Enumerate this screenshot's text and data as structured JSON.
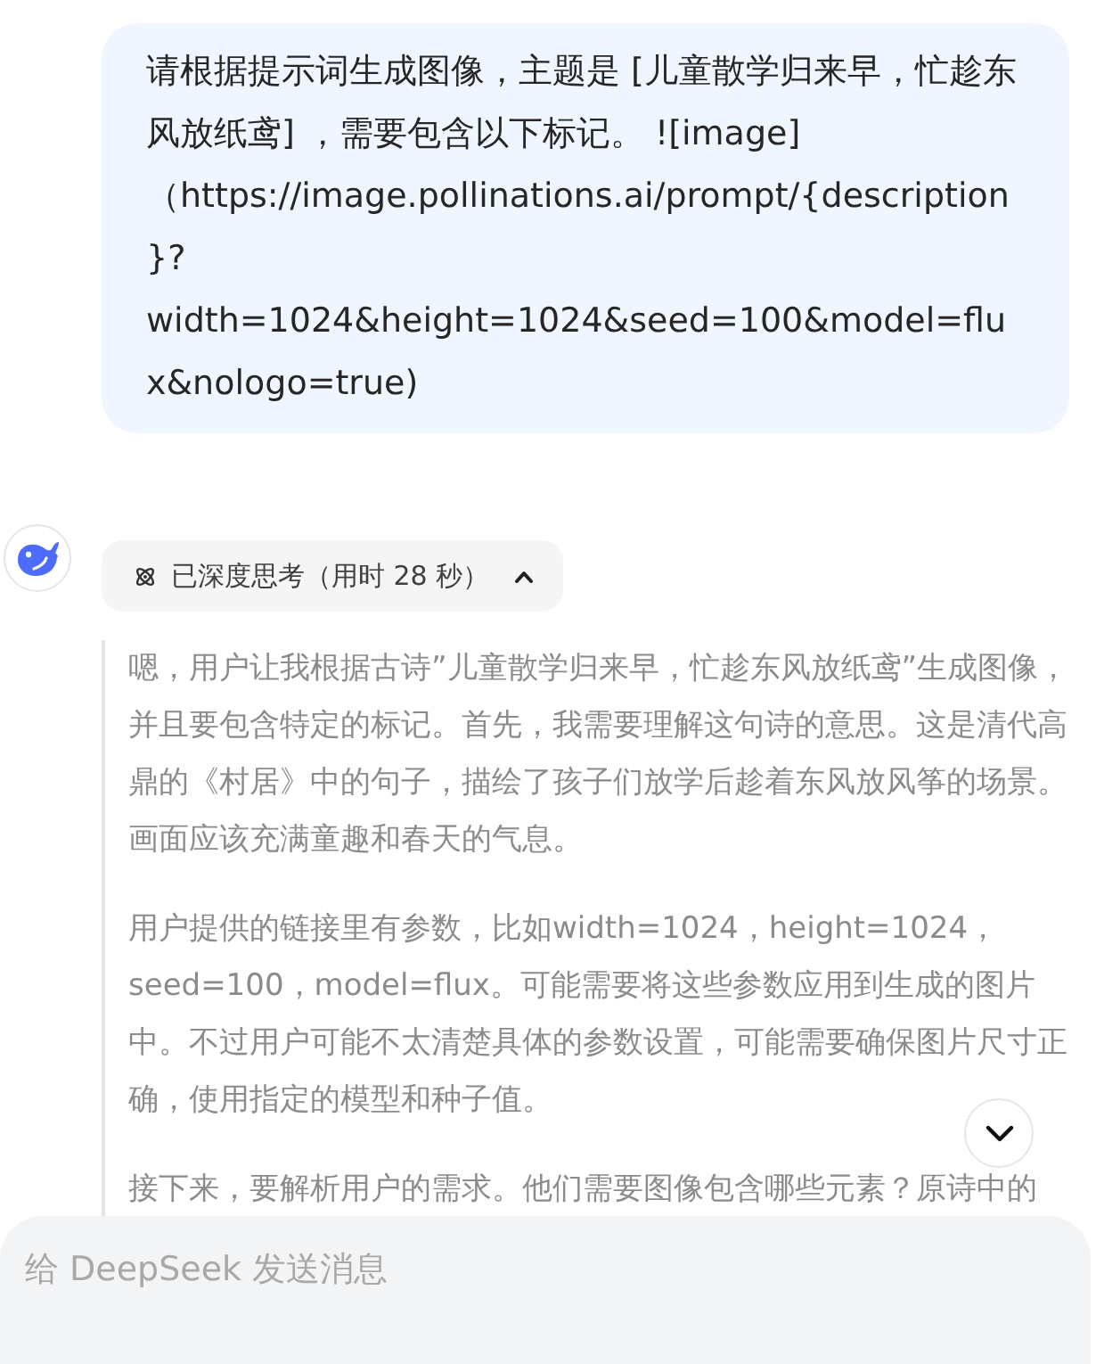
{
  "user_message": {
    "text": "请根据提示词生成图像，主题是 [儿童散学归来早，忙趁东风放纸鸢] ，需要包含以下标记。 ![image]（https://image.pollinations.ai/prompt/{description}?width=1024&height=1024&seed=100&model=flux&nologo=true)"
  },
  "assistant": {
    "thinking_toggle": {
      "label": "已深度思考（用时 28 秒）",
      "expanded": true
    },
    "thinking_paragraphs": [
      "嗯，用户让我根据古诗”儿童散学归来早，忙趁东风放纸鸢”生成图像，并且要包含特定的标记。首先，我需要理解这句诗的意思。这是清代高鼎的《村居》中的句子，描绘了孩子们放学后趁着东风放风筝的场景。画面应该充满童趣和春天的气息。",
      "用户提供的链接里有参数，比如width=1024，height=1024，seed=100，model=flux。可能需要将这些参数应用到生成的图片中。不过用户可能不太清楚具体的参数设置，可能需要确保图片尺寸正确，使用指定的模型和种子值。",
      "接下来，要解析用户的需求。他们需要图像包含哪些元素？原诗中的"
    ]
  },
  "composer": {
    "placeholder": "给 DeepSeek 发送消息"
  }
}
